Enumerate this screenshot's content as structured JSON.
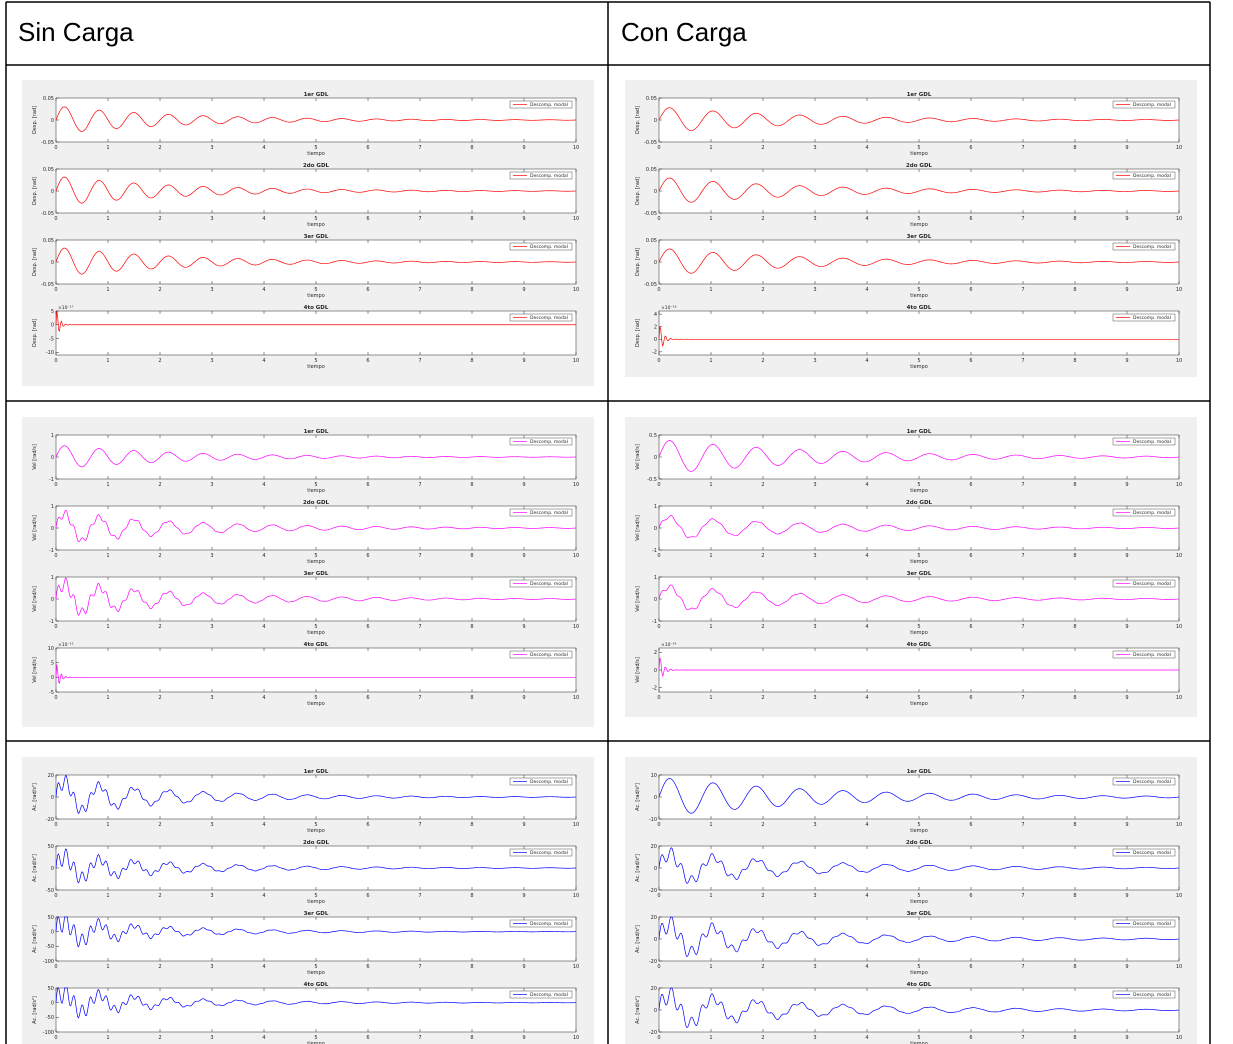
{
  "table": {
    "headers": [
      "Sin Carga",
      "Con Carga"
    ]
  },
  "common": {
    "xlabel": "tiempo",
    "legend": "Descomp. modal",
    "subplot_titles": [
      "1er GDL",
      "2do GDL",
      "3er GDL",
      "4to GDL"
    ],
    "x_ticks": [
      "0",
      "1",
      "2",
      "3",
      "4",
      "5",
      "6",
      "7",
      "8",
      "9",
      "10"
    ]
  },
  "colors": {
    "displacement": "#ff0000",
    "velocity": "#ff00ff",
    "acceleration": "#0000ff",
    "figure_bg": "#f0f0f0"
  },
  "chart_data": [
    {
      "type": "line",
      "name": "Sin Carga - Desplazamiento",
      "color": "#ff0000",
      "xlim": [
        0,
        10
      ],
      "subplots": [
        {
          "title": "1er GDL",
          "ylabel": "Desp. [rad]",
          "yticks": [
            "0.05",
            "0",
            "-0.05"
          ],
          "ylim": [
            -0.05,
            0.05
          ],
          "exponent": "",
          "amp": 0.032,
          "freq": 1.5,
          "decay": 0.42,
          "noise": 0
        },
        {
          "title": "2do GDL",
          "ylabel": "Desp. [rad]",
          "yticks": [
            "0.05",
            "0",
            "-0.05"
          ],
          "ylim": [
            -0.05,
            0.05
          ],
          "exponent": "",
          "amp": 0.034,
          "freq": 1.5,
          "decay": 0.42,
          "noise": 0
        },
        {
          "title": "3er GDL",
          "ylabel": "Desp. [rad]",
          "yticks": [
            "0.05",
            "0",
            "-0.05"
          ],
          "ylim": [
            -0.05,
            0.05
          ],
          "exponent": "",
          "amp": 0.034,
          "freq": 1.5,
          "decay": 0.42,
          "noise": 0
        },
        {
          "title": "4to GDL",
          "ylabel": "Desp. [rad]",
          "yticks": [
            "5",
            "0",
            "-5",
            "-10"
          ],
          "ylim": [
            -11,
            5
          ],
          "exponent": "×10⁻¹⁷",
          "amp": 8,
          "freq": 12,
          "decay": 18,
          "noise": 0
        }
      ]
    },
    {
      "type": "line",
      "name": "Con Carga - Desplazamiento",
      "color": "#ff0000",
      "xlim": [
        0,
        10
      ],
      "subplots": [
        {
          "title": "1er GDL",
          "ylabel": "Desp. [rad]",
          "yticks": [
            "0.05",
            "0",
            "-0.05"
          ],
          "ylim": [
            -0.05,
            0.05
          ],
          "exponent": "",
          "amp": 0.03,
          "freq": 1.2,
          "decay": 0.36,
          "noise": 0
        },
        {
          "title": "2do GDL",
          "ylabel": "Desp. [rad]",
          "yticks": [
            "0.05",
            "0",
            "-0.05"
          ],
          "ylim": [
            -0.05,
            0.05
          ],
          "exponent": "",
          "amp": 0.032,
          "freq": 1.2,
          "decay": 0.36,
          "noise": 0
        },
        {
          "title": "3er GDL",
          "ylabel": "Desp. [rad]",
          "yticks": [
            "0.05",
            "0",
            "-0.05"
          ],
          "ylim": [
            -0.05,
            0.05
          ],
          "exponent": "",
          "amp": 0.032,
          "freq": 1.2,
          "decay": 0.36,
          "noise": 0
        },
        {
          "title": "4to GDL",
          "ylabel": "Desp. [rad]",
          "yticks": [
            "4",
            "2",
            "0",
            "-2"
          ],
          "ylim": [
            -2.5,
            4.5
          ],
          "exponent": "×10⁻¹⁶",
          "amp": 3,
          "freq": 10,
          "decay": 14,
          "noise": 0
        }
      ]
    },
    {
      "type": "line",
      "name": "Sin Carga - Velocidad",
      "color": "#ff00ff",
      "xlim": [
        0,
        10
      ],
      "subplots": [
        {
          "title": "1er GDL",
          "ylabel": "Vel [rad/s]",
          "yticks": [
            "1",
            "0",
            "-1"
          ],
          "ylim": [
            -1,
            1
          ],
          "exponent": "",
          "amp": 0.55,
          "freq": 1.5,
          "decay": 0.42,
          "noise": 0
        },
        {
          "title": "2do GDL",
          "ylabel": "Vel [rad/s]",
          "yticks": [
            "1",
            "0",
            "-1"
          ],
          "ylim": [
            -1,
            1
          ],
          "exponent": "",
          "amp": 0.7,
          "freq": 1.5,
          "decay": 0.38,
          "noise": 0.3
        },
        {
          "title": "3er GDL",
          "ylabel": "Vel [rad/s]",
          "yticks": [
            "1",
            "0",
            "-1"
          ],
          "ylim": [
            -1,
            1
          ],
          "exponent": "",
          "amp": 0.75,
          "freq": 1.5,
          "decay": 0.38,
          "noise": 0.45
        },
        {
          "title": "4to GDL",
          "ylabel": "Vel [rad/s]",
          "yticks": [
            "10",
            "5",
            "0",
            "-5"
          ],
          "ylim": [
            -5,
            10
          ],
          "exponent": "×10⁻¹⁵",
          "amp": 6,
          "freq": 12,
          "decay": 16,
          "noise": 0
        }
      ]
    },
    {
      "type": "line",
      "name": "Con Carga - Velocidad",
      "color": "#ff00ff",
      "xlim": [
        0,
        10
      ],
      "subplots": [
        {
          "title": "1er GDL",
          "ylabel": "Vel [rad/s]",
          "yticks": [
            "0.5",
            "0",
            "-0.5"
          ],
          "ylim": [
            -0.5,
            0.5
          ],
          "exponent": "",
          "amp": 0.4,
          "freq": 1.2,
          "decay": 0.32,
          "noise": 0
        },
        {
          "title": "2do GDL",
          "ylabel": "Vel [rad/s]",
          "yticks": [
            "1",
            "0",
            "-1"
          ],
          "ylim": [
            -1,
            1
          ],
          "exponent": "",
          "amp": 0.55,
          "freq": 1.2,
          "decay": 0.33,
          "noise": 0.15
        },
        {
          "title": "3er GDL",
          "ylabel": "Vel [rad/s]",
          "yticks": [
            "1",
            "0",
            "-1"
          ],
          "ylim": [
            -1,
            1
          ],
          "exponent": "",
          "amp": 0.6,
          "freq": 1.2,
          "decay": 0.33,
          "noise": 0.2
        },
        {
          "title": "4to GDL",
          "ylabel": "Vel [rad/s]",
          "yticks": [
            "2",
            "0",
            "-2"
          ],
          "ylim": [
            -2.5,
            2.5
          ],
          "exponent": "×10⁻¹⁴",
          "amp": 2,
          "freq": 10,
          "decay": 14,
          "noise": 0
        }
      ]
    },
    {
      "type": "line",
      "name": "Sin Carga - Aceleración",
      "color": "#0000ff",
      "xlim": [
        0,
        10
      ],
      "subplots": [
        {
          "title": "1er GDL",
          "ylabel": "Ac. [rad/s²]",
          "yticks": [
            "20",
            "0",
            "-20"
          ],
          "ylim": [
            -20,
            20
          ],
          "exponent": "",
          "amp": 15,
          "freq": 1.5,
          "decay": 0.42,
          "noise": 0.5
        },
        {
          "title": "2do GDL",
          "ylabel": "Ac. [rad/s²]",
          "yticks": [
            "50",
            "0",
            "-50"
          ],
          "ylim": [
            -50,
            50
          ],
          "exponent": "",
          "amp": 28,
          "freq": 1.5,
          "decay": 0.4,
          "noise": 0.8
        },
        {
          "title": "3er GDL",
          "ylabel": "Ac. [rad/s²]",
          "yticks": [
            "50",
            "0",
            "-50",
            "-100"
          ],
          "ylim": [
            -100,
            50
          ],
          "exponent": "",
          "amp": 40,
          "freq": 1.5,
          "decay": 0.45,
          "noise": 1.0
        },
        {
          "title": "4to GDL",
          "ylabel": "Ac. [rad/s²]",
          "yticks": [
            "50",
            "0",
            "-50",
            "-100"
          ],
          "ylim": [
            -100,
            50
          ],
          "exponent": "",
          "amp": 40,
          "freq": 1.5,
          "decay": 0.45,
          "noise": 1.0
        }
      ]
    },
    {
      "type": "line",
      "name": "Con Carga - Aceleración",
      "color": "#0000ff",
      "xlim": [
        0,
        10
      ],
      "subplots": [
        {
          "title": "1er GDL",
          "ylabel": "Ac. [rad/s²]",
          "yticks": [
            "10",
            "0",
            "-10"
          ],
          "ylim": [
            -10,
            10
          ],
          "exponent": "",
          "amp": 9,
          "freq": 1.2,
          "decay": 0.32,
          "noise": 0
        },
        {
          "title": "2do GDL",
          "ylabel": "Ac. [rad/s²]",
          "yticks": [
            "20",
            "0",
            "-20"
          ],
          "ylim": [
            -20,
            20
          ],
          "exponent": "",
          "amp": 14,
          "freq": 1.2,
          "decay": 0.33,
          "noise": 0.5
        },
        {
          "title": "3er GDL",
          "ylabel": "Ac. [rad/s²]",
          "yticks": [
            "20",
            "0",
            "-20"
          ],
          "ylim": [
            -20,
            20
          ],
          "exponent": "",
          "amp": 15,
          "freq": 1.2,
          "decay": 0.33,
          "noise": 0.6
        },
        {
          "title": "4to GDL",
          "ylabel": "Ac. [rad/s²]",
          "yticks": [
            "20",
            "0",
            "-20"
          ],
          "ylim": [
            -20,
            20
          ],
          "exponent": "",
          "amp": 15,
          "freq": 1.2,
          "decay": 0.33,
          "noise": 0.6
        }
      ]
    }
  ]
}
